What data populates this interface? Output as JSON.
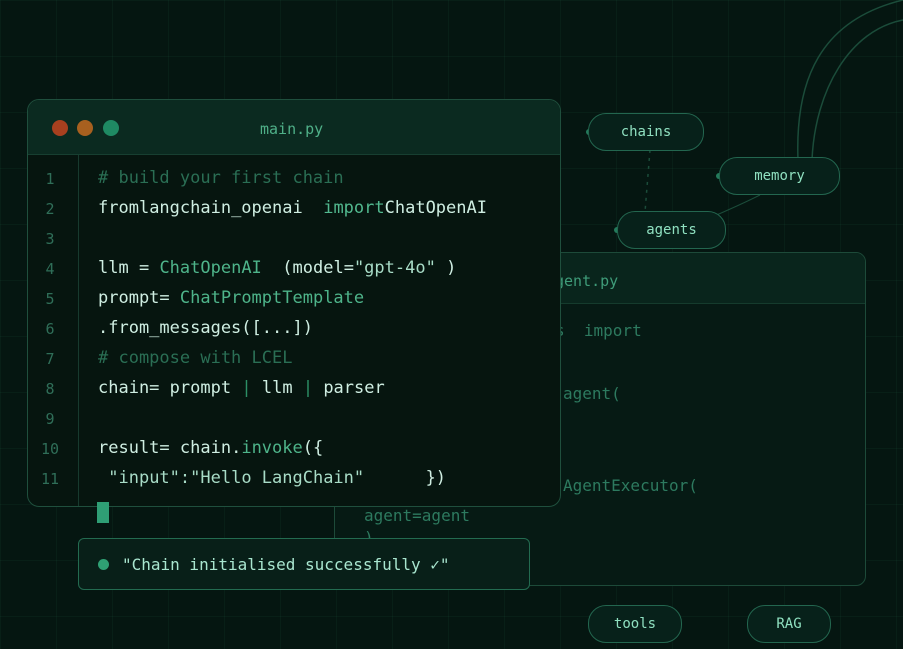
{
  "colors": {
    "background": "#051611",
    "accent": "#2fa074",
    "window_border": "#1f4f3d",
    "traffic_red": "#a8401f",
    "traffic_yellow": "#a8601f",
    "traffic_green": "#1f8a63"
  },
  "main_window": {
    "title": "main.py",
    "line_numbers": [
      "1",
      "2",
      "3",
      "4",
      "5",
      "6",
      "7",
      "8",
      "9",
      "10",
      "11"
    ],
    "lines": {
      "l1": {
        "comment": "# build your first chain"
      },
      "l2": {
        "kw_from": "from",
        "module": "langchain_openai",
        "kw_import": "import",
        "name": "ChatOpenAI"
      },
      "l4": {
        "var": "llm =",
        "fn": "ChatOpenAI",
        "open": "(model=",
        "str": "\"gpt-4o\"",
        "close": ")"
      },
      "l5": {
        "var": "prompt=",
        "fn": "ChatPromptTemplate"
      },
      "l6": {
        "text": ".from_messages([...])"
      },
      "l7": {
        "comment": "# compose with LCEL"
      },
      "l8": {
        "var": "chain=",
        "a": "prompt",
        "b": "llm",
        "c": "parser",
        "pipe": "|"
      },
      "l10": {
        "var": "result=",
        "obj": "chain.",
        "fn": "invoke",
        "open": "({"
      },
      "l11": {
        "key": "\"input\":",
        "str": "\"Hello LangChain\"",
        "close": "})"
      }
    }
  },
  "back_window": {
    "title_fragment": "gent.py",
    "lines": [
      "s  import",
      "agent(",
      "AgentExecutor(",
      "agent=agent",
      ")"
    ]
  },
  "toast": {
    "message": "\"Chain initialised successfully ✓\""
  },
  "nodes": {
    "chains": "chains",
    "memory": "memory",
    "agents": "agents",
    "tools": "tools",
    "rag": "RAG"
  }
}
